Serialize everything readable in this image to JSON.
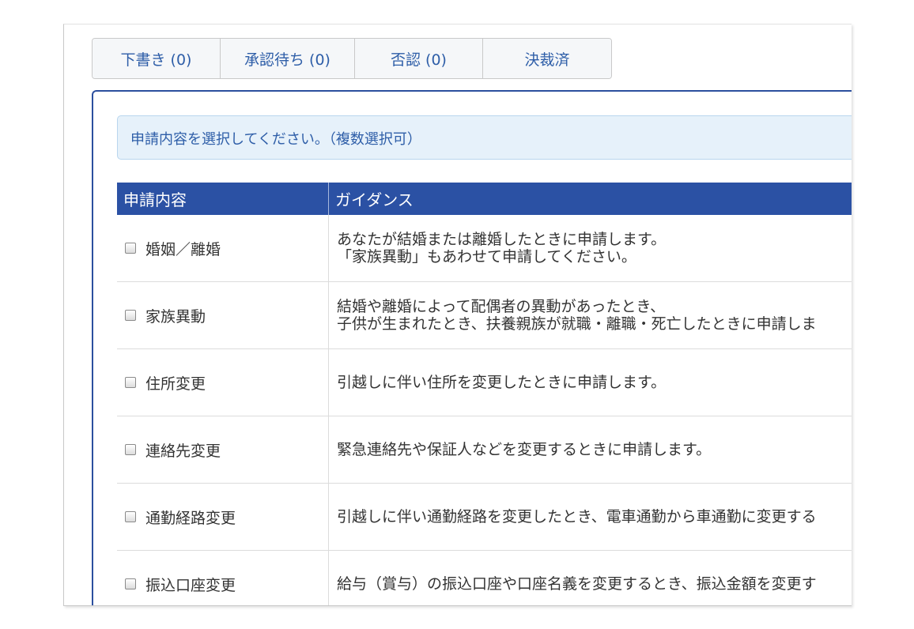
{
  "tabs": [
    {
      "label": "下書き (0)"
    },
    {
      "label": "承認待ち (0)"
    },
    {
      "label": "否認 (0)"
    },
    {
      "label": "決裁済"
    }
  ],
  "info_message": "申請内容を選択してください。（複数選択可）",
  "table": {
    "headers": [
      "申請内容",
      "ガイダンス"
    ],
    "rows": [
      {
        "name": "婚姻／離婚",
        "guidance_line1": "あなたが結婚または離婚したときに申請します。",
        "guidance_line2": "「家族異動」もあわせて申請してください。"
      },
      {
        "name": "家族異動",
        "guidance_line1": "結婚や離婚によって配偶者の異動があったとき、",
        "guidance_line2": "子供が生まれたとき、扶養親族が就職・離職・死亡したときに申請しま"
      },
      {
        "name": "住所変更",
        "guidance_line1": "引越しに伴い住所を変更したときに申請します。",
        "guidance_line2": ""
      },
      {
        "name": "連絡先変更",
        "guidance_line1": "緊急連絡先や保証人などを変更するときに申請します。",
        "guidance_line2": ""
      },
      {
        "name": "通勤経路変更",
        "guidance_line1": "引越しに伴い通勤経路を変更したとき、電車通勤から車通勤に変更する",
        "guidance_line2": ""
      },
      {
        "name": "振込口座変更",
        "guidance_line1": "給与（賞与）の振込口座や口座名義を変更するとき、振込金額を変更す",
        "guidance_line2": ""
      }
    ]
  }
}
